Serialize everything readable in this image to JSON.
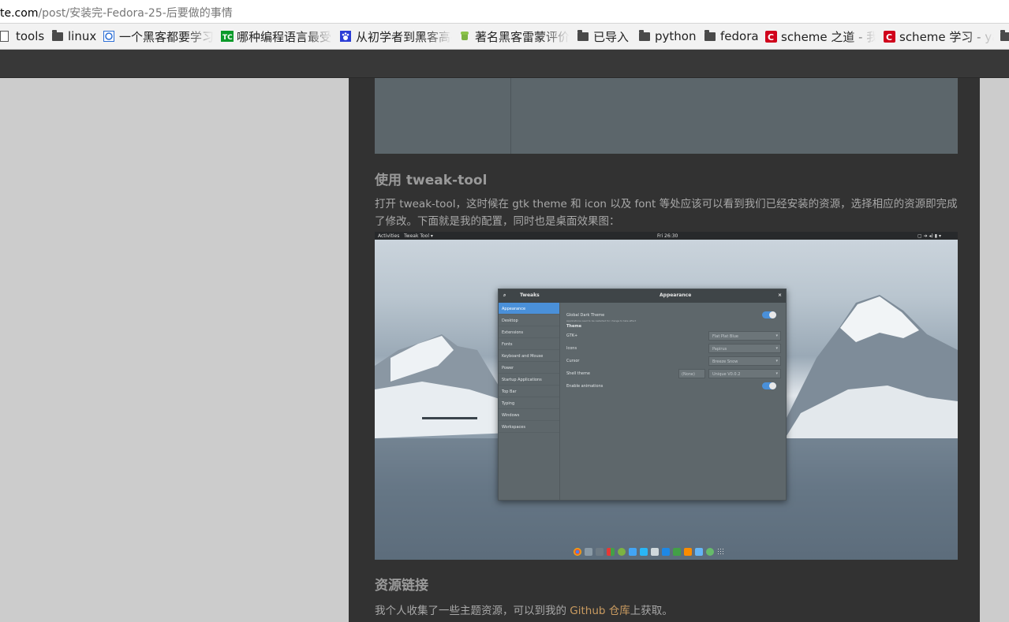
{
  "browser": {
    "url_host": "te.com",
    "url_path": "/post/安装完-Fedora-25-后要做的事情"
  },
  "bookmarks": [
    {
      "label": "tools",
      "icon": "page-icon"
    },
    {
      "label": "linux",
      "icon": "folder-icon"
    },
    {
      "label": "一个黑客都要学习",
      "icon": "site-icon"
    },
    {
      "label": "哪种编程语言最受",
      "icon": "site-icon"
    },
    {
      "label": "从初学者到黑客高手",
      "icon": "paw-icon"
    },
    {
      "label": "著名黑客雷蒙评价",
      "icon": "android-icon"
    },
    {
      "label": "已导入",
      "icon": "folder-icon"
    },
    {
      "label": "python",
      "icon": "folder-icon"
    },
    {
      "label": "fedora",
      "icon": "folder-icon"
    },
    {
      "label": "scheme 之道 - 我",
      "icon": "c-icon"
    },
    {
      "label": "scheme 学习 - ya",
      "icon": "c-icon"
    }
  ],
  "article": {
    "section1_title": "使用 tweak-tool",
    "section1_text": "打开 tweak-tool，这时候在 gtk theme 和 icon 以及 font 等处应该可以看到我们已经安装的资源，选择相应的资源即完成了修改。下面就是我的配置，同时也是桌面效果图：",
    "section2_title": "资源链接",
    "section2_text_before": "我个人收集了一些主题资源，可以到我的 ",
    "section2_link": "Github 仓库",
    "section2_text_after": "上获取。"
  },
  "screenshot": {
    "topbar": {
      "activities": "Activities",
      "app": "Tweak Tool ▾",
      "clock": "Fri 26:30"
    },
    "window": {
      "title_left": "Tweaks",
      "title_center": "Appearance",
      "close": "×",
      "sidebar": [
        "Appearance",
        "Desktop",
        "Extensions",
        "Fonts",
        "Keyboard and Mouse",
        "Power",
        "Startup Applications",
        "Top Bar",
        "Typing",
        "Windows",
        "Workspaces"
      ],
      "settings": {
        "dark_theme": "Global Dark Theme",
        "dark_note": "Applications need to be restarted for change to take effect",
        "theme_header": "Theme",
        "gtk_label": "GTK+",
        "gtk_value": "Flat Plat Blue",
        "icons_label": "Icons",
        "icons_value": "Papirus",
        "cursor_label": "Cursor",
        "cursor_value": "Breeze Snow",
        "shell_label": "Shell theme",
        "shell_none": "(None)",
        "shell_value": "Unique V0.0.2",
        "anim_label": "Enable animations"
      }
    }
  },
  "colors": {
    "accent": "#4a90d9",
    "link": "#c99b60",
    "text": "#a8a8a8",
    "heading": "#9a9a9a",
    "background": "#323232"
  }
}
